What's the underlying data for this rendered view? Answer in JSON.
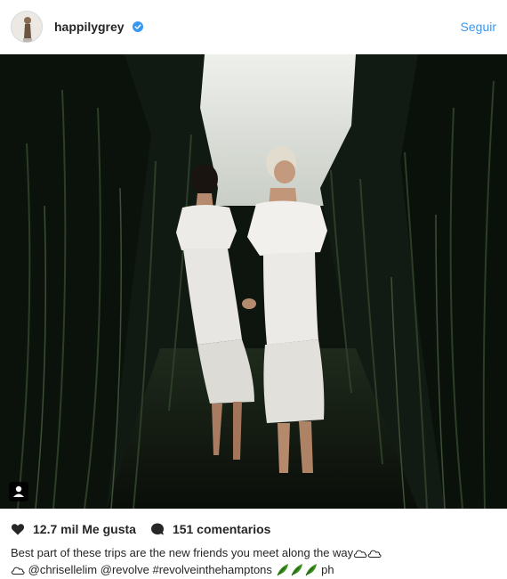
{
  "post": {
    "username": "happilygrey",
    "follow_label": "Seguir",
    "likes_text": "12.7 mil Me gusta",
    "comments_text": "151 comentarios",
    "caption_text": "Best part of these trips are the new friends you meet along the way",
    "mention_1": "@chrisellelim",
    "mention_2": "@revolve",
    "hashtag": "#revolveinthehamptons",
    "caption_tail": "ph"
  },
  "colors": {
    "link": "#3897f0",
    "text": "#262626",
    "verified": "#3897f0",
    "leaf": "#3b8f1f"
  },
  "icons": [
    "verified-badge-icon",
    "heart-icon",
    "comment-bubble-icon",
    "cloud-emoji",
    "herb-emoji",
    "person-tag-icon"
  ]
}
